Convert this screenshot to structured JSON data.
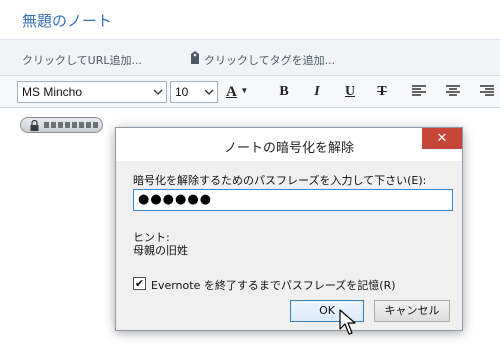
{
  "note": {
    "title": "無題のノート",
    "url_placeholder": "クリックしてURL追加...",
    "tag_placeholder": "クリックしてタグを追加..."
  },
  "toolbar": {
    "font_name": "MS Mincho",
    "font_size": "10",
    "color_glyph": "A",
    "bold_glyph": "B",
    "italic_glyph": "I",
    "underline_glyph": "U",
    "strike_glyph": "T"
  },
  "dialog": {
    "title": "ノートの暗号化を解除",
    "close_glyph": "✕",
    "prompt": "暗号化を解除するためのパスフレーズを入力して下さい(E):",
    "password_masked": "●●●●●●",
    "hint_label": "ヒント:",
    "hint_value": "母親の旧姓",
    "remember_checked_glyph": "✔",
    "remember_label": "Evernote を終了するまでパスフレーズを記憶(R)",
    "ok_label": "OK",
    "cancel_label": "キャンセル"
  },
  "icons": [
    "tag-icon",
    "chevron-down-icon",
    "text-color-icon",
    "align-left-icon",
    "align-center-icon",
    "align-right-icon",
    "lock-icon",
    "close-icon",
    "mouse-cursor-icon"
  ]
}
